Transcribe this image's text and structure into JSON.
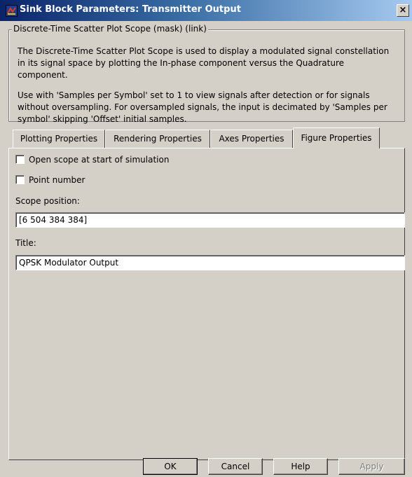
{
  "window": {
    "title": "Sink Block Parameters: Transmitter Output",
    "close_glyph": "×"
  },
  "group": {
    "legend": "Discrete-Time Scatter Plot Scope (mask) (link)",
    "description_1": "The Discrete-Time Scatter Plot Scope is used to display a modulated signal constellation in its signal space by plotting the In-phase component versus the Quadrature component.",
    "description_2": "Use with 'Samples per Symbol' set to 1 to view signals after detection or for signals without oversampling.  For oversampled signals, the input is decimated by 'Samples per symbol' skipping 'Offset' initial samples."
  },
  "tabs": [
    {
      "label": "Plotting Properties"
    },
    {
      "label": "Rendering Properties"
    },
    {
      "label": "Axes Properties"
    },
    {
      "label": "Figure Properties"
    }
  ],
  "active_tab": "Figure Properties",
  "figure": {
    "open_scope_label": "Open scope at start of simulation",
    "open_scope_checked": false,
    "point_number_label": "Point number",
    "point_number_checked": false,
    "scope_position_label": "Scope position:",
    "scope_position_value": "[6 504 384 384]",
    "title_label": "Title:",
    "title_value": "QPSK Modulator Output"
  },
  "buttons": {
    "ok": "OK",
    "cancel": "Cancel",
    "help": "Help",
    "apply": "Apply"
  }
}
